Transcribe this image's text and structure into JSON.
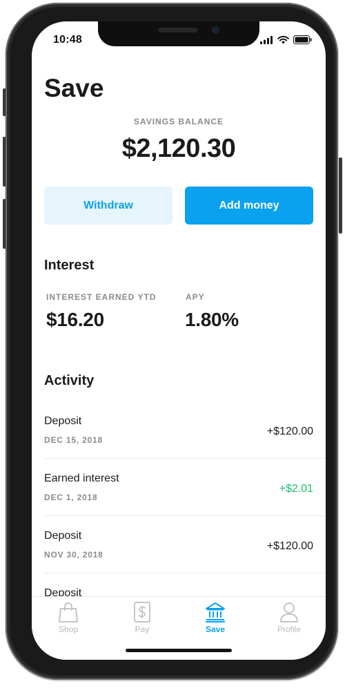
{
  "status_bar": {
    "time": "10:48"
  },
  "page": {
    "title": "Save"
  },
  "balance": {
    "label": "SAVINGS BALANCE",
    "amount": "$2,120.30"
  },
  "actions": {
    "withdraw_label": "Withdraw",
    "add_money_label": "Add money"
  },
  "interest": {
    "title": "Interest",
    "earned_label": "INTEREST EARNED YTD",
    "earned_value": "$16.20",
    "apy_label": "APY",
    "apy_value": "1.80%"
  },
  "activity": {
    "title": "Activity",
    "items": [
      {
        "title": "Deposit",
        "date": "DEC 15, 2018",
        "amount": "+$120.00"
      },
      {
        "title": "Earned interest",
        "date": "DEC 1, 2018",
        "amount": "+$2.01"
      },
      {
        "title": "Deposit",
        "date": "NOV 30, 2018",
        "amount": "+$120.00"
      },
      {
        "title": "Deposit",
        "date": "",
        "amount": ""
      }
    ]
  },
  "tabs": [
    {
      "label": "Shop",
      "icon": "shopping-bag-icon",
      "active": false
    },
    {
      "label": "Pay",
      "icon": "dollar-receipt-icon",
      "active": false
    },
    {
      "label": "Save",
      "icon": "bank-icon",
      "active": true
    },
    {
      "label": "Profile",
      "icon": "person-icon",
      "active": false
    }
  ],
  "colors": {
    "accent": "#0aa2ef",
    "accent_light": "#e6f4fc",
    "positive": "#19c26a",
    "muted": "#8a8a8a"
  }
}
